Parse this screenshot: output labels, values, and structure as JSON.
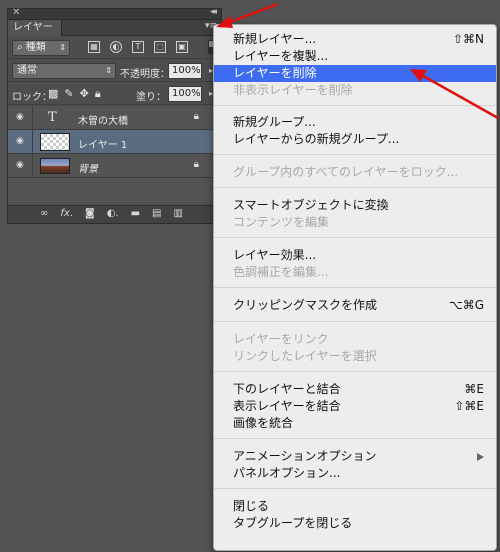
{
  "panel": {
    "tab_label": "レイヤー",
    "filter_label": "種類",
    "blend_mode": "通常",
    "opacity_label": "不透明度：",
    "opacity_value": "100%",
    "lock_label": "ロック：",
    "fill_label": "塗り：",
    "fill_value": "100%",
    "layers": [
      {
        "name": "木曽の大橋",
        "type": "text",
        "locked": true
      },
      {
        "name": "レイヤー 1",
        "type": "transparent",
        "selected": true
      },
      {
        "name": "背景",
        "type": "photo",
        "locked": true
      }
    ]
  },
  "menu": {
    "items": [
      {
        "label": "新規レイヤー...",
        "shortcut": "⇧⌘N"
      },
      {
        "label": "レイヤーを複製..."
      },
      {
        "label": "レイヤーを削除",
        "highlighted": true
      },
      {
        "label": "非表示レイヤーを削除",
        "disabled": true
      },
      {
        "label": "新規グループ..."
      },
      {
        "label": "レイヤーからの新規グループ..."
      },
      {
        "label": "グループ内のすべてのレイヤーをロック...",
        "disabled": true
      },
      {
        "label": "スマートオブジェクトに変換"
      },
      {
        "label": "コンテンツを編集",
        "disabled": true
      },
      {
        "label": "レイヤー効果..."
      },
      {
        "label": "色調補正を編集...",
        "disabled": true
      },
      {
        "label": "クリッピングマスクを作成",
        "shortcut": "⌥⌘G"
      },
      {
        "label": "レイヤーをリンク",
        "disabled": true
      },
      {
        "label": "リンクしたレイヤーを選択",
        "disabled": true
      },
      {
        "label": "下のレイヤーと結合",
        "shortcut": "⌘E"
      },
      {
        "label": "表示レイヤーを結合",
        "shortcut": "⇧⌘E"
      },
      {
        "label": "画像を統合"
      },
      {
        "label": "アニメーションオプション",
        "submenu": true
      },
      {
        "label": "パネルオプション..."
      },
      {
        "label": "閉じる"
      },
      {
        "label": "タブグループを閉じる"
      }
    ]
  },
  "colors": {
    "highlight": "#3e6cf0",
    "arrow": "#e01010"
  }
}
